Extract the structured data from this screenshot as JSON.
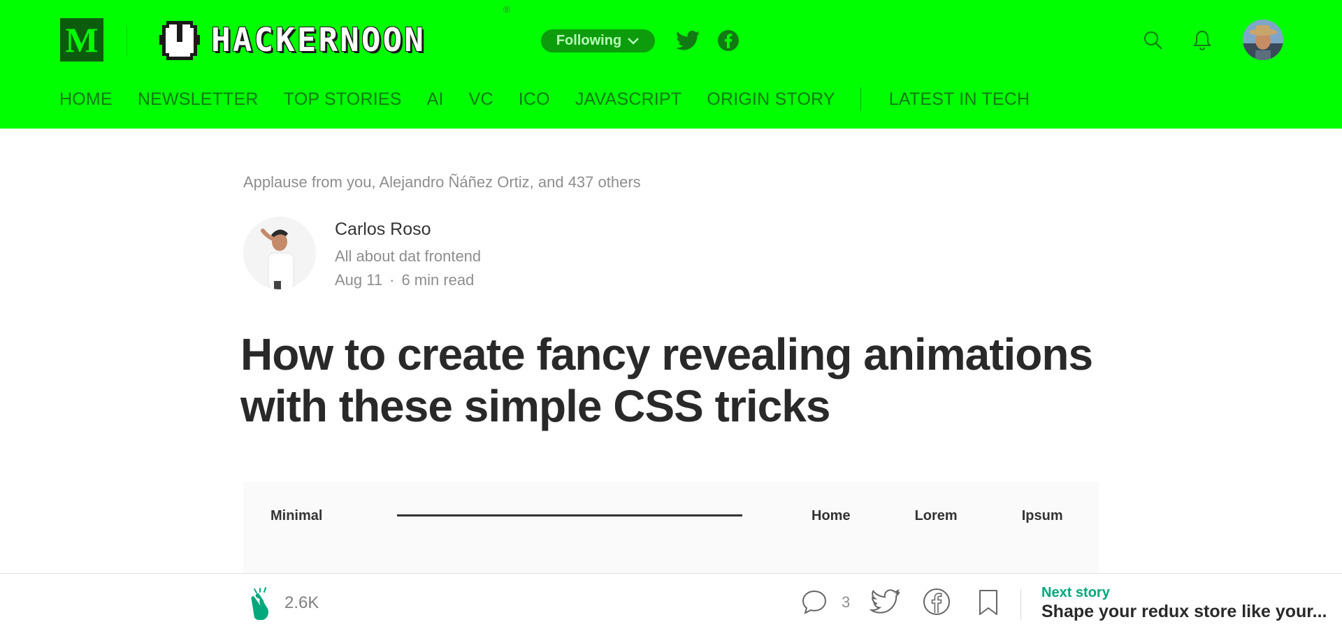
{
  "colors": {
    "header_bg": "#00ff00",
    "nav_text": "#127a12",
    "follow_bg": "#0c9c0c",
    "accent_green": "#03a87c",
    "logo_bg": "#0d5c0d"
  },
  "header": {
    "medium_logo": "M",
    "publication_name": "HACKERNOON",
    "publication_reg": "®",
    "follow_label": "Following",
    "icons": {
      "twitter": "twitter-icon",
      "facebook": "facebook-icon",
      "search": "search-icon",
      "bell": "bell-icon"
    }
  },
  "nav": {
    "items": [
      "HOME",
      "NEWSLETTER",
      "TOP STORIES",
      "AI",
      "VC",
      "ICO",
      "JAVASCRIPT",
      "ORIGIN STORY"
    ],
    "extra": "LATEST IN TECH"
  },
  "article": {
    "applause": "Applause from you, Alejandro Ñáñez Ortiz, and 437 others",
    "author": {
      "name": "Carlos Roso",
      "bio": "All about dat frontend",
      "date": "Aug 11",
      "separator": "·",
      "read_time": "6 min read"
    },
    "title": "How to create fancy revealing animations with these simple CSS tricks",
    "figure": {
      "logo": "Minimal",
      "links": [
        "Home",
        "Lorem",
        "Ipsum"
      ]
    }
  },
  "bottom_bar": {
    "clap_count": "2.6K",
    "response_count": "3",
    "next_label": "Next story",
    "next_title": "Shape your redux store like your..."
  }
}
